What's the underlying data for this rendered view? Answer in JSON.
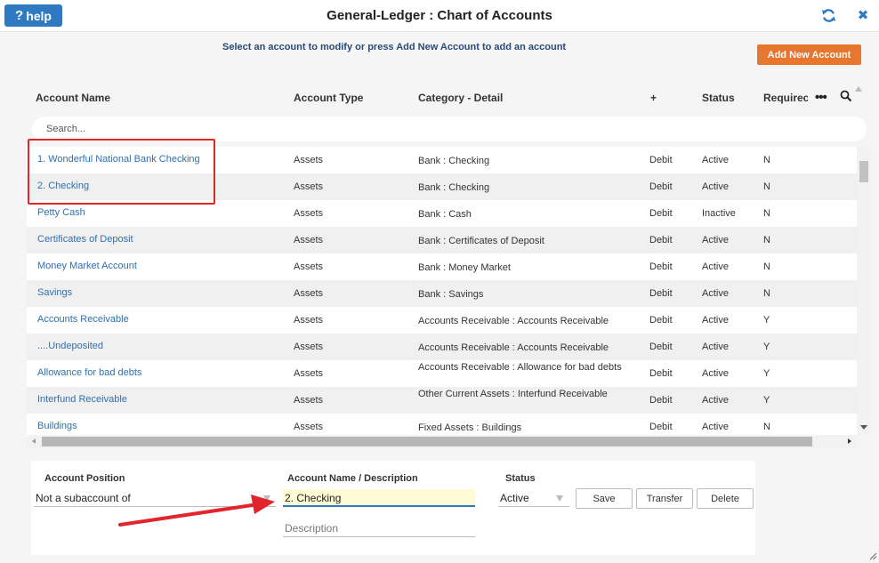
{
  "header": {
    "help_label": "help",
    "help_glyph": "?",
    "title": "General-Ledger : Chart of Accounts",
    "close_glyph": "✖"
  },
  "toolbar": {
    "instruction": "Select an account to modify or press Add New Account to add an account",
    "add_label": "Add New Account"
  },
  "grid": {
    "columns": {
      "name": "Account Name",
      "type": "Account Type",
      "category": "Category - Detail",
      "plus": "+",
      "status": "Status",
      "required": "Requirec",
      "more": "•••"
    },
    "search_placeholder": "Search...",
    "rows": [
      {
        "name": "1. Wonderful National Bank Checking",
        "type": "Assets",
        "category": "Bank : Checking",
        "dc": "Debit",
        "status": "Active",
        "req": "N"
      },
      {
        "name": "2. Checking",
        "type": "Assets",
        "category": "Bank : Checking",
        "dc": "Debit",
        "status": "Active",
        "req": "N"
      },
      {
        "name": "Petty Cash",
        "type": "Assets",
        "category": "Bank : Cash",
        "dc": "Debit",
        "status": "Inactive",
        "req": "N"
      },
      {
        "name": "Certificates of Deposit",
        "type": "Assets",
        "category": "Bank : Certificates of Deposit",
        "dc": "Debit",
        "status": "Active",
        "req": "N"
      },
      {
        "name": "Money Market Account",
        "type": "Assets",
        "category": "Bank : Money Market",
        "dc": "Debit",
        "status": "Active",
        "req": "N"
      },
      {
        "name": "Savings",
        "type": "Assets",
        "category": "Bank : Savings",
        "dc": "Debit",
        "status": "Active",
        "req": "N"
      },
      {
        "name": "Accounts Receivable",
        "type": "Assets",
        "category": "Accounts Receivable : Accounts Receivable",
        "dc": "Debit",
        "status": "Active",
        "req": "Y"
      },
      {
        "name": "....Undeposited",
        "type": "Assets",
        "category": "Accounts Receivable : Accounts Receivable",
        "dc": "Debit",
        "status": "Active",
        "req": "Y"
      },
      {
        "name": "Allowance for bad debts",
        "type": "Assets",
        "category": "Accounts Receivable : Allowance for bad debts",
        "dc": "Debit",
        "status": "Active",
        "req": "Y"
      },
      {
        "name": "Interfund Receivable",
        "type": "Assets",
        "category": "Other Current Assets : Interfund Receivable",
        "dc": "Debit",
        "status": "Active",
        "req": "Y"
      },
      {
        "name": "Buildings",
        "type": "Assets",
        "category": "Fixed Assets : Buildings",
        "dc": "Debit",
        "status": "Active",
        "req": "N"
      }
    ]
  },
  "form": {
    "position_label": "Account Position",
    "position_value": "Not a subaccount of",
    "name_label": "Account Name / Description",
    "name_value": "2. Checking",
    "description_placeholder": "Description",
    "status_label": "Status",
    "status_value": "Active",
    "save_label": "Save",
    "transfer_label": "Transfer",
    "delete_label": "Delete"
  },
  "colors": {
    "link": "#2f6fb5",
    "primary": "#2f79c0",
    "accent": "#e8762d",
    "annotation": "#e0262c"
  }
}
